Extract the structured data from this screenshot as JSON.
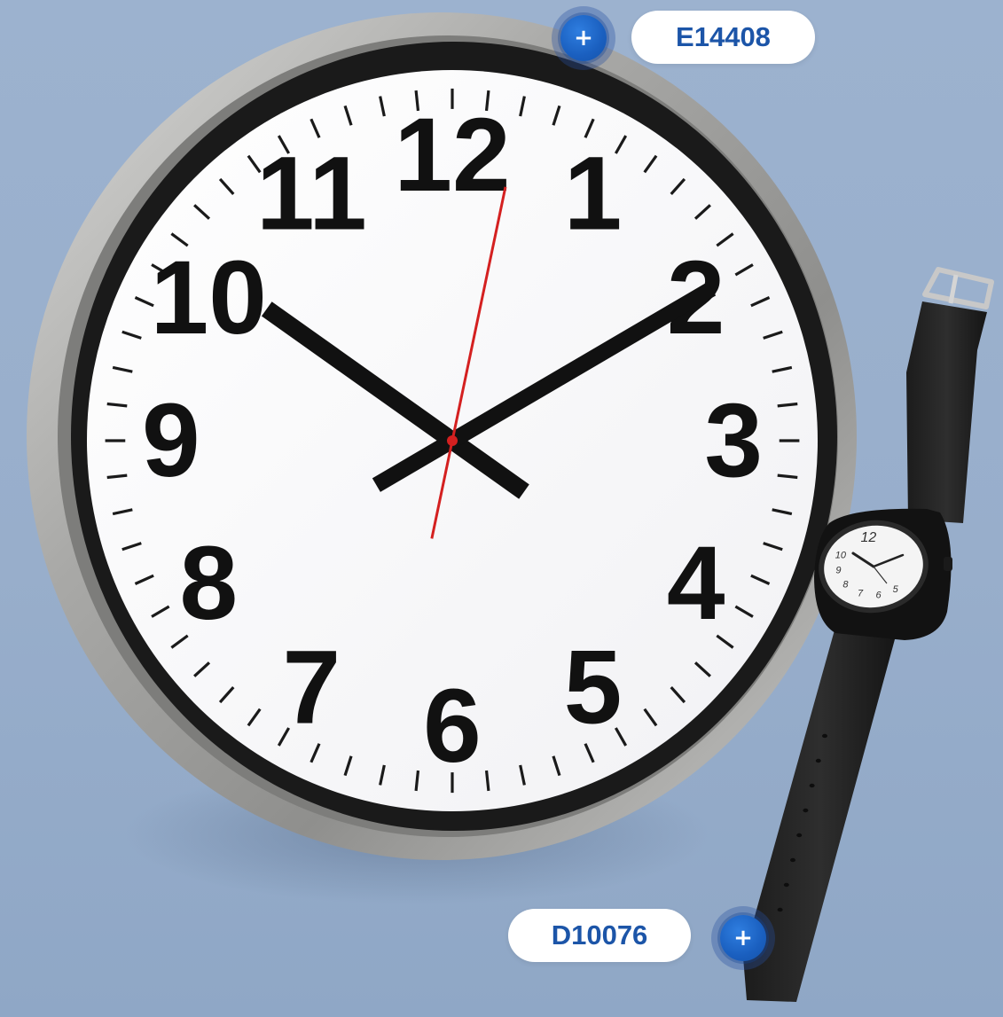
{
  "products": [
    {
      "code": "E14408",
      "hotspot_icon": "plus-icon"
    },
    {
      "code": "D10076",
      "hotspot_icon": "plus-icon"
    }
  ],
  "wall_clock": {
    "numerals": [
      "12",
      "1",
      "2",
      "3",
      "4",
      "5",
      "6",
      "7",
      "8",
      "9",
      "10",
      "11"
    ],
    "time": {
      "hour": 10,
      "minute": 10,
      "second": 2
    }
  },
  "wristwatch": {
    "visible_numerals": [
      "12",
      "10",
      "9",
      "8",
      "7",
      "6",
      "5"
    ]
  },
  "colors": {
    "background": "#9cb2cf",
    "accent": "#1c55a8",
    "second_hand": "#d42020",
    "tag_bg": "#ffffff"
  },
  "hotspot_glyph": "+"
}
